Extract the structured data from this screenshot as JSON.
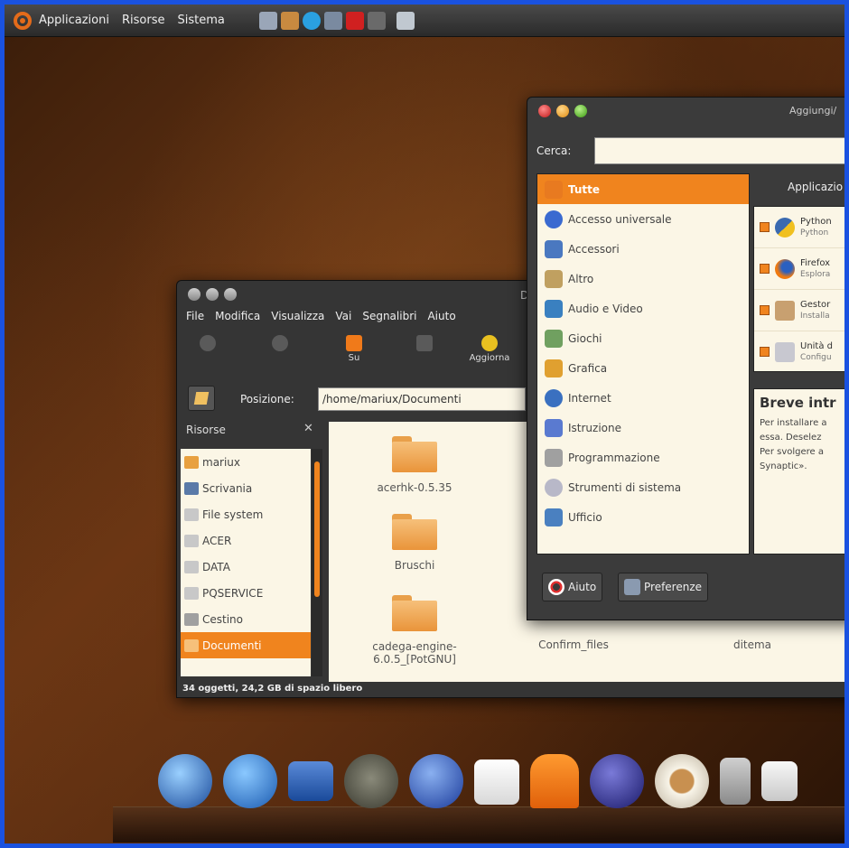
{
  "top_panel": {
    "menus": [
      "Applicazioni",
      "Risorse",
      "Sistema"
    ]
  },
  "file_manager": {
    "title": "D",
    "menu": [
      "File",
      "Modifica",
      "Visualizza",
      "Vai",
      "Segnalibri",
      "Aiuto"
    ],
    "toolbar": {
      "up_label": "Su",
      "reload_label": "Aggiorna"
    },
    "location_label": "Posizione:",
    "location_value": "/home/mariux/Documenti",
    "side_pane": {
      "header": "Risorse",
      "close": "✕",
      "items": [
        "mariux",
        "Scrivania",
        "File system",
        "ACER",
        "DATA",
        "PQSERVICE",
        "Cestino",
        "Documenti"
      ]
    },
    "items": [
      {
        "name": "acerhk-0.5.35"
      },
      {
        "name": "Bruschi"
      },
      {
        "name": "cadega-engine-6.0.5_[PotGNU]"
      },
      {
        "name": "Confirm_files"
      },
      {
        "name": "ditema"
      }
    ],
    "status": "34 oggetti, 24,2 GB di spazio libero"
  },
  "apps_window": {
    "title": "Aggiungi/",
    "search_label": "Cerca:",
    "search_value": "",
    "categories": [
      "Tutte",
      "Accesso universale",
      "Accessori",
      "Altro",
      "Audio e Video",
      "Giochi",
      "Grafica",
      "Internet",
      "Istruzione",
      "Programmazione",
      "Strumenti di sistema",
      "Ufficio"
    ],
    "apps_header": "Applicazio",
    "apps": [
      {
        "name": "Python",
        "sub": "Python"
      },
      {
        "name": "Firefox",
        "sub": "Esplora"
      },
      {
        "name": "Gestor",
        "sub": "Installa"
      },
      {
        "name": "Unità d",
        "sub": "Configu"
      }
    ],
    "desc_title": "Breve intr",
    "desc_lines": [
      "Per installare a",
      "essa. Deselez",
      "Per svolgere a",
      "Synaptic»."
    ],
    "help_label": "Aiuto",
    "prefs_label": "Preferenze"
  },
  "colors": {
    "accent": "#f0841e",
    "frame": "#1a52e0"
  }
}
